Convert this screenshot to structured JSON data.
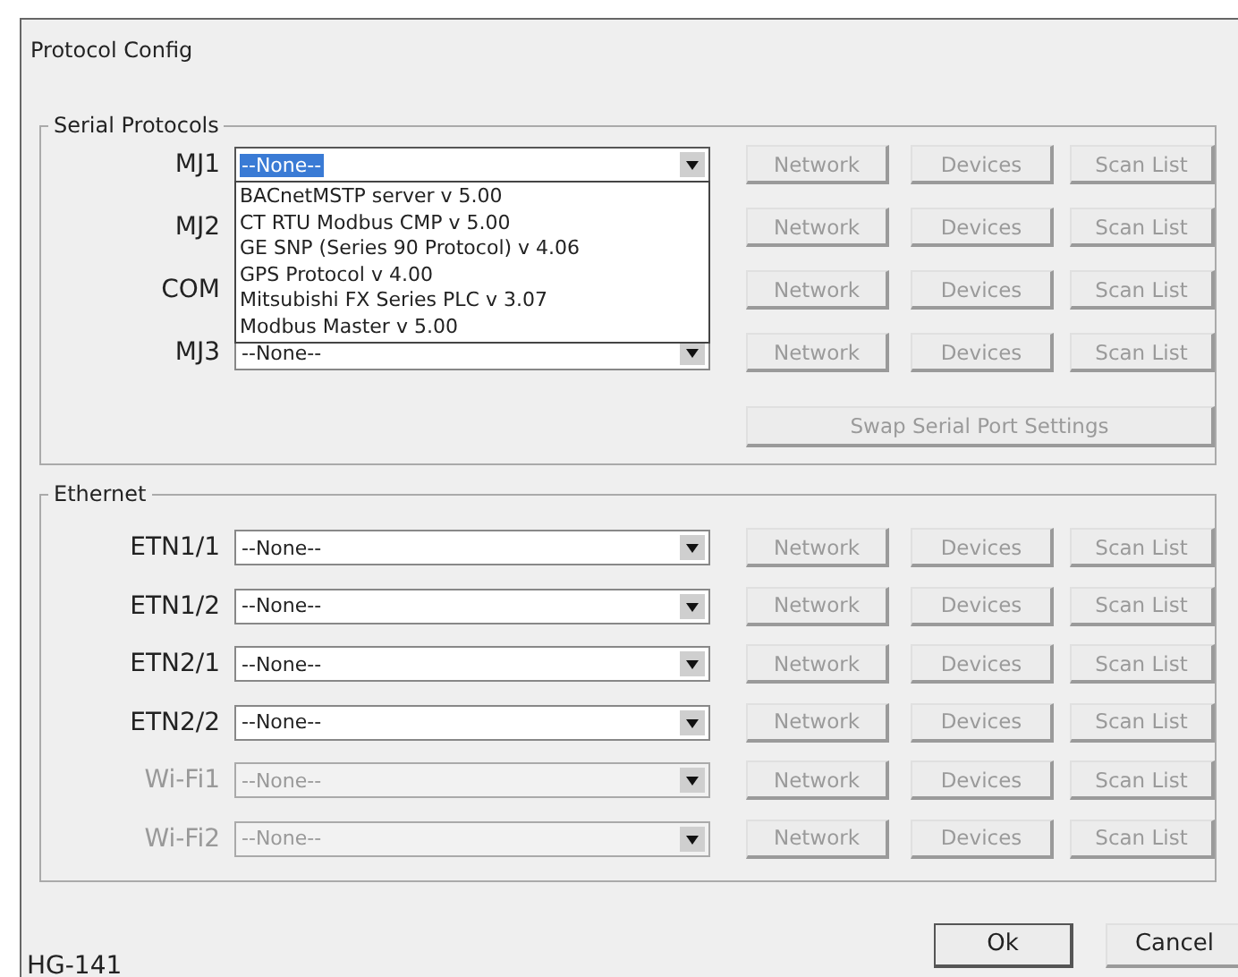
{
  "window": {
    "title": "Protocol Config"
  },
  "serial_protocols": {
    "title": "Serial Protocols",
    "rows": [
      {
        "label": "MJ1",
        "value": "--None--",
        "value_highlighted": true,
        "disabled": false,
        "expanded": true,
        "options": [
          {
            "label": "BACnetMSTP server v 5.00",
            "selected": false
          },
          {
            "label": "CT RTU Modbus CMP v 5.00",
            "selected": false
          },
          {
            "label": "GE SNP (Series 90 Protocol) v 4.06",
            "selected": false
          },
          {
            "label": "GPS Protocol v 4.00",
            "selected": false
          },
          {
            "label": "Mitsubishi FX Series PLC v 3.07",
            "selected": false
          },
          {
            "label": "Modbus Master v 5.00",
            "selected": false
          }
        ],
        "buttons": [
          {
            "label": "Network",
            "disabled": true
          },
          {
            "label": "Devices",
            "disabled": true
          },
          {
            "label": "Scan List",
            "disabled": true
          }
        ]
      },
      {
        "label": "MJ2",
        "buttons": [
          {
            "label": "Network",
            "disabled": true
          },
          {
            "label": "Devices",
            "disabled": true
          },
          {
            "label": "Scan List",
            "disabled": true
          }
        ]
      },
      {
        "label": "COM",
        "buttons": [
          {
            "label": "Network",
            "disabled": true
          },
          {
            "label": "Devices",
            "disabled": true
          },
          {
            "label": "Scan List",
            "disabled": true
          }
        ]
      },
      {
        "label": "MJ3",
        "value": "--None--",
        "disabled": false,
        "buttons": [
          {
            "label": "Network",
            "disabled": true
          },
          {
            "label": "Devices",
            "disabled": true
          },
          {
            "label": "Scan List",
            "disabled": true
          }
        ]
      }
    ],
    "swap_button": {
      "label": "Swap Serial Port Settings",
      "disabled": true
    }
  },
  "ethernet": {
    "title": "Ethernet",
    "rows": [
      {
        "label": "ETN1/1",
        "value": "--None--",
        "disabled": false,
        "buttons": [
          {
            "label": "Network",
            "disabled": true
          },
          {
            "label": "Devices",
            "disabled": true
          },
          {
            "label": "Scan List",
            "disabled": true
          }
        ]
      },
      {
        "label": "ETN1/2",
        "value": "--None--",
        "disabled": false,
        "buttons": [
          {
            "label": "Network",
            "disabled": true
          },
          {
            "label": "Devices",
            "disabled": true
          },
          {
            "label": "Scan List",
            "disabled": true
          }
        ]
      },
      {
        "label": "ETN2/1",
        "value": "--None--",
        "disabled": false,
        "buttons": [
          {
            "label": "Network",
            "disabled": true
          },
          {
            "label": "Devices",
            "disabled": true
          },
          {
            "label": "Scan List",
            "disabled": true
          }
        ]
      },
      {
        "label": "ETN2/2",
        "value": "--None--",
        "disabled": false,
        "buttons": [
          {
            "label": "Network",
            "disabled": true
          },
          {
            "label": "Devices",
            "disabled": true
          },
          {
            "label": "Scan List",
            "disabled": true
          }
        ]
      },
      {
        "label": "Wi-Fi1",
        "value": "--None--",
        "disabled": true,
        "buttons": [
          {
            "label": "Network",
            "disabled": true
          },
          {
            "label": "Devices",
            "disabled": true
          },
          {
            "label": "Scan List",
            "disabled": true
          }
        ]
      },
      {
        "label": "Wi-Fi2",
        "value": "--None--",
        "disabled": true,
        "buttons": [
          {
            "label": "Network",
            "disabled": true
          },
          {
            "label": "Devices",
            "disabled": true
          },
          {
            "label": "Scan List",
            "disabled": true
          }
        ]
      }
    ]
  },
  "footer": {
    "model": "HG-141",
    "buttons": [
      {
        "label": "Ok",
        "default": true
      },
      {
        "label": "Cancel",
        "default": false
      }
    ]
  }
}
